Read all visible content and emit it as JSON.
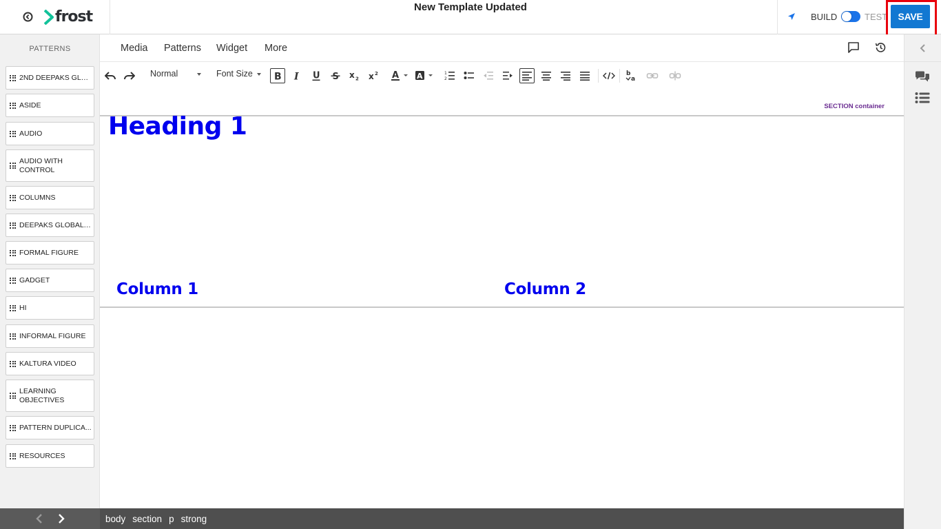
{
  "app": {
    "brand_name": "frost",
    "document_title": "New Template Updated",
    "mode_build_label": "BUILD",
    "mode_test_label": "TEST",
    "save_label": "SAVE",
    "accent_color": "#1278d2",
    "logo_chevron_color": "#12c29a"
  },
  "sidebar": {
    "heading": "PATTERNS",
    "patterns": [
      "2ND DEEPAKS GLO...",
      "ASIDE",
      "AUDIO",
      "AUDIO WITH CONTROL",
      "COLUMNS",
      "DEEPAKS GLOBAL ...",
      "FORMAL FIGURE",
      "GADGET",
      "HI",
      "INFORMAL FIGURE",
      "KALTURA VIDEO",
      "LEARNING OBJECTIVES",
      "PATTERN DUPLICA...",
      "RESOURCES"
    ]
  },
  "tabs": [
    "Media",
    "Patterns",
    "Widget",
    "More"
  ],
  "toolbar": {
    "block_format": "Normal",
    "font_size": "Font Size",
    "buttons": [
      "undo-icon",
      "redo-icon",
      "bold-icon",
      "italic-icon",
      "underline-icon",
      "strikethrough-icon",
      "subscript-icon",
      "superscript-icon",
      "text-color-icon",
      "background-color-icon",
      "numbered-list-icon",
      "bulleted-list-icon",
      "outdent-icon",
      "indent-icon",
      "align-left-icon",
      "align-center-icon",
      "align-right-icon",
      "justify-icon",
      "source-code-icon",
      "spellcheck-icon",
      "link-icon",
      "unlink-icon"
    ]
  },
  "editor": {
    "section_tag": "SECTION container",
    "heading": "Heading 1",
    "column_1": "Column 1",
    "column_2": "Column 2",
    "heading_color": "#0000ee"
  },
  "path": [
    "body",
    "section",
    "p",
    "strong"
  ]
}
